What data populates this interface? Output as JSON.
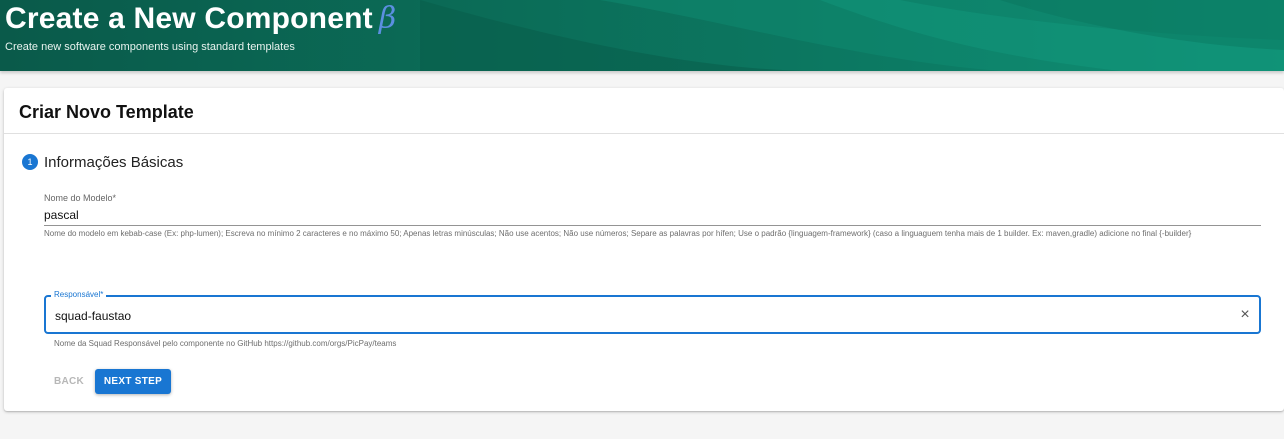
{
  "header": {
    "title": "Create a New Component",
    "beta_symbol": "β",
    "subtitle": "Create new software components using standard templates"
  },
  "card": {
    "title": "Criar Novo Template",
    "step": {
      "number": "1",
      "label": "Informações Básicas"
    },
    "model_field": {
      "label": "Nome do Modelo*",
      "value": "pascal",
      "help": "Nome do modelo em kebab-case (Ex: php-lumen); Escreva no mínimo 2 caracteres e no máximo 50; Apenas letras minúsculas; Não use acentos; Não use números; Separe as palavras por hífen; Use o padrão {linguagem-framework} (caso a linguaguem tenha mais de 1 builder. Ex: maven,gradle) adicione no final {-builder}"
    },
    "owner_field": {
      "label": "Responsável*",
      "value": "squad-faustao",
      "clear_icon": "×",
      "help": "Nome da Squad Responsável pelo componente no GitHub https://github.com/orgs/PicPay/teams"
    },
    "buttons": {
      "back": "BACK",
      "next": "NEXT STEP"
    }
  },
  "colors": {
    "header_bg": "#0b6d58",
    "primary": "#1976d2",
    "beta": "#5b8fe0"
  }
}
